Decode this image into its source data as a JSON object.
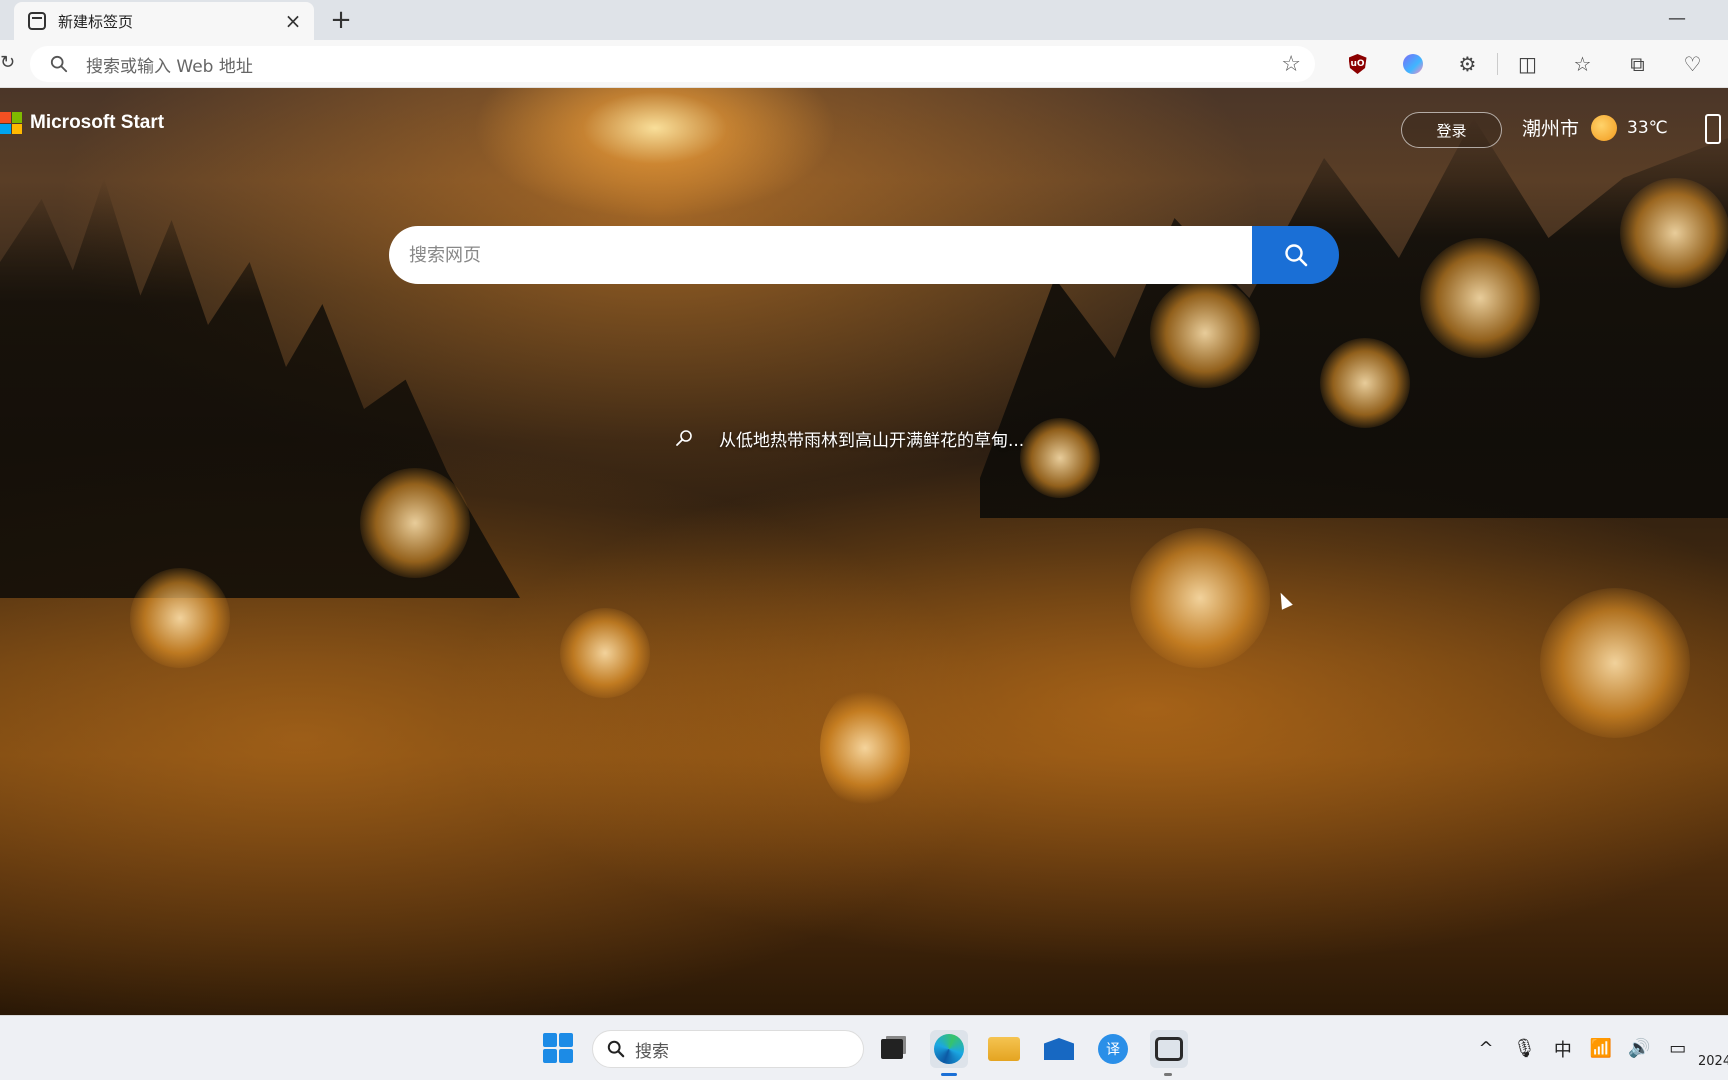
{
  "browser": {
    "tab": {
      "title": "新建标签页",
      "close": "×"
    },
    "new_tab": "+",
    "minimize": "—",
    "address": {
      "placeholder": "搜索或输入 Web 地址",
      "value": ""
    },
    "toolbar_icons": [
      "ublock-icon",
      "copilot-icon",
      "extensions-icon",
      "split-screen-icon",
      "favorites-icon",
      "collections-icon",
      "browser-essentials-icon"
    ]
  },
  "page": {
    "brand": "Microsoft Start",
    "login": "登录",
    "weather": {
      "city": "潮州市",
      "temp": "33℃"
    },
    "search": {
      "placeholder": "搜索网页"
    },
    "caption": "从低地热带雨林到高山开满鲜花的草甸..."
  },
  "taskbar": {
    "search": "搜索",
    "apps": [
      "start-icon",
      "task-view-icon",
      "edge-icon",
      "file-explorer-icon",
      "mail-icon",
      "translate-icon",
      "screen-record-icon"
    ],
    "translate_glyph": "译",
    "tray": {
      "chevron": "^",
      "mic": "🎙",
      "ime": "中",
      "wifi": "📶",
      "volume": "🔊",
      "battery": "▭"
    },
    "clock_fragment": "2024"
  },
  "colors": {
    "search_button": "#1a6fd6",
    "taskbar": "#eef0f4",
    "tab_active": "#f7f7f7"
  }
}
